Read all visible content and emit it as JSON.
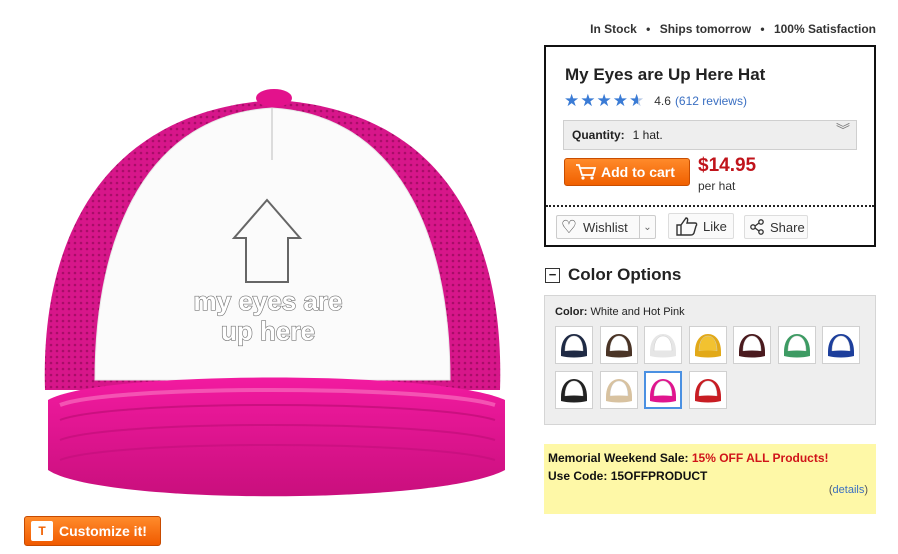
{
  "product": {
    "title": "My Eyes are Up Here Hat",
    "rating": "4.6",
    "reviews": "(612 reviews)",
    "price": "$14.95",
    "per_unit": "per hat"
  },
  "status": {
    "in_stock": "In Stock",
    "ships": "Ships tomorrow",
    "satisfaction": "100% Satisfaction",
    "separator": "•"
  },
  "quantity": {
    "label": "Quantity:",
    "value": "1 hat."
  },
  "actions": {
    "add_to_cart": "Add to cart",
    "wishlist": "Wishlist",
    "like": "Like",
    "share": "Share",
    "customize": "Customize it!",
    "customize_icon_text": "T"
  },
  "hat_print": {
    "line1": "my eyes are",
    "line2": "up here"
  },
  "colors": {
    "section_title": "Color Options",
    "collapse_symbol": "−",
    "label": "Color:",
    "selected": "White and Hot Pink",
    "swatches": [
      {
        "name": "White and Navy",
        "crown": "#ffffff",
        "mesh": "#1f2a44"
      },
      {
        "name": "White and Brown",
        "crown": "#ffffff",
        "mesh": "#4a3426"
      },
      {
        "name": "White",
        "crown": "#ffffff",
        "mesh": "#e6e6e6"
      },
      {
        "name": "Gold",
        "crown": "#f2c230",
        "mesh": "#e2a918"
      },
      {
        "name": "White and Maroon",
        "crown": "#ffffff",
        "mesh": "#4a1a1e"
      },
      {
        "name": "White and Kelly Green",
        "crown": "#ffffff",
        "mesh": "#3d9b63"
      },
      {
        "name": "White and Royal Blue",
        "crown": "#ffffff",
        "mesh": "#1d3f9c"
      },
      {
        "name": "White and Black",
        "crown": "#ffffff",
        "mesh": "#222222"
      },
      {
        "name": "Khaki",
        "crown": "#ffffff",
        "mesh": "#d8c2a0"
      },
      {
        "name": "White and Hot Pink",
        "crown": "#ffffff",
        "mesh": "#e0158e",
        "selected": true
      },
      {
        "name": "White and Red",
        "crown": "#ffffff",
        "mesh": "#c81d23"
      }
    ]
  },
  "sale": {
    "prefix": "Memorial Weekend Sale:",
    "highlight": "15% OFF ALL Products!",
    "code_label": "Use Code:",
    "code": "15OFFPRODUCT",
    "details": "details"
  },
  "theme": {
    "pink": "#e0158e",
    "orange": "#f06000",
    "price_red": "#c0141b",
    "link_blue": "#3a6fc2"
  }
}
